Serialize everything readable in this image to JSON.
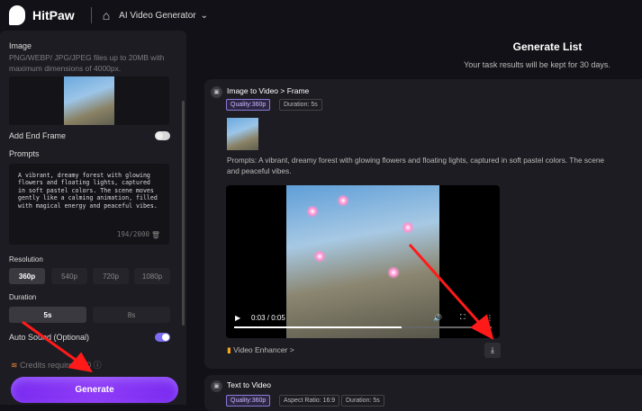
{
  "header": {
    "brand": "HitPaw",
    "breadcrumb": "AI Video Generator",
    "home_icon": "home-icon"
  },
  "left": {
    "image_label": "Image",
    "image_hint": "PNG/WEBP/ JPG/JPEG files up to 20MB with maximum dimensions of 4000px.",
    "end_frame_label": "Add End Frame",
    "end_frame_on": false,
    "prompts_label": "Prompts",
    "prompt": "A vibrant, dreamy forest with glowing flowers and floating lights, captured in soft pastel colors. The scene moves gently like a calming animation, filled with magical energy and peaceful vibes.",
    "char_count": "194/2000",
    "resolution_label": "Resolution",
    "resolutions": [
      "360p",
      "540p",
      "720p",
      "1080p"
    ],
    "resolution_selected": "360p",
    "duration_label": "Duration",
    "durations": [
      "5s",
      "8s"
    ],
    "duration_selected": "5s",
    "auto_sound_label": "Auto Sound (Optional)",
    "auto_sound_on": true,
    "credits": "Credits required: 40",
    "generate": "Generate"
  },
  "main": {
    "title": "Generate List",
    "subtitle": "Your task results will be kept for 30 days.",
    "tasks": [
      {
        "title": "Image to Video > Frame",
        "tags": [
          "Quality:360p",
          "Duration: 5s"
        ],
        "prompt": "Prompts:  A vibrant, dreamy forest with glowing flowers and floating lights, captured in soft pastel colors. The scene",
        "prompt2": "and peaceful vibes.",
        "time": "0:03 / 0:05",
        "progress": 0.65,
        "enhancer": "Video Enhancer >"
      },
      {
        "title": "Text to Video",
        "tags": [
          "Quality:360p",
          "Aspect Ratio: 16:9",
          "Duration: 5s"
        ]
      }
    ]
  },
  "colors": {
    "accent": "#7b6cf0",
    "generate": "#8a34f5",
    "annotation": "#ff1a1a"
  }
}
